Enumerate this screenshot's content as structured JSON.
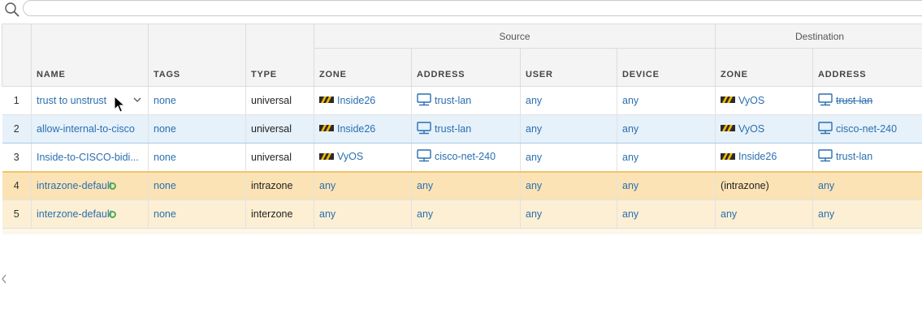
{
  "search": {
    "placeholder": ""
  },
  "groups": {
    "source": "Source",
    "destination": "Destination"
  },
  "columns": {
    "name": "NAME",
    "tags": "TAGS",
    "type": "TYPE",
    "src_zone": "ZONE",
    "src_address": "ADDRESS",
    "src_user": "USER",
    "src_device": "DEVICE",
    "dst_zone": "ZONE",
    "dst_address": "ADDRESS"
  },
  "rows": [
    {
      "num": "1",
      "name": "trust to unstrust",
      "tags": "none",
      "type": "universal",
      "src_zone": "Inside26",
      "src_address": "trust-lan",
      "src_user": "any",
      "src_device": "any",
      "dst_zone": "VyOS",
      "dst_address": "trust-lan"
    },
    {
      "num": "2",
      "name": "allow-internal-to-cisco",
      "tags": "none",
      "type": "universal",
      "src_zone": "Inside26",
      "src_address": "trust-lan",
      "src_user": "any",
      "src_device": "any",
      "dst_zone": "VyOS",
      "dst_address": "cisco-net-240"
    },
    {
      "num": "3",
      "name": "Inside-to-CISCO-bidi...",
      "tags": "none",
      "type": "universal",
      "src_zone": "VyOS",
      "src_address": "cisco-net-240",
      "src_user": "any",
      "src_device": "any",
      "dst_zone": "Inside26",
      "dst_address": "trust-lan"
    },
    {
      "num": "4",
      "name": "intrazone-default",
      "tags": "none",
      "type": "intrazone",
      "src_zone": "any",
      "src_address": "any",
      "src_user": "any",
      "src_device": "any",
      "dst_zone": "(intrazone)",
      "dst_address": "any"
    },
    {
      "num": "5",
      "name": "interzone-default",
      "tags": "none",
      "type": "interzone",
      "src_zone": "any",
      "src_address": "any",
      "src_user": "any",
      "src_device": "any",
      "dst_zone": "any",
      "dst_address": "any"
    }
  ],
  "icons": {
    "zone": "zone-icon",
    "address": "address-icon",
    "search": "search-icon",
    "override": "override-icon",
    "chevron": "chevron-down-icon"
  },
  "colors": {
    "link": "#2a6fb0",
    "selected_row": "#e6f1fa",
    "default_rule": "#fbe3b6"
  }
}
